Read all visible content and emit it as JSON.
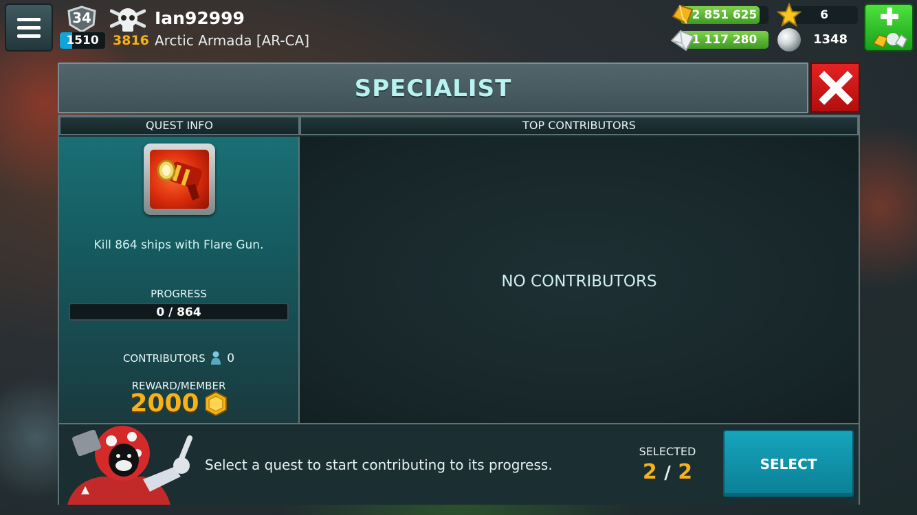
{
  "player": {
    "rank": "34",
    "xp": "1510",
    "kills": "3816",
    "username": "Ian92999",
    "guild": "Arctic Armada [AR-CA]"
  },
  "resources": {
    "gold": "2 851 625",
    "iron": "1 117 280",
    "stars": "6",
    "pearls": "1348",
    "gold_fill": 0.9,
    "iron_fill": 1.0
  },
  "dialog": {
    "title": "SPECIALIST",
    "quest_info_header": "QUEST INFO",
    "top_contributors_header": "TOP CONTRIBUTORS",
    "quest_description": "Kill 864 ships with Flare Gun.",
    "progress_label": "PROGRESS",
    "progress_text": "0 / 864",
    "progress_fraction": 0,
    "contributors_label": "CONTRIBUTORS",
    "contributors_count": "0",
    "reward_label": "REWARD/MEMBER",
    "reward_value": "2000",
    "no_contributors": "NO CONTRIBUTORS"
  },
  "footer": {
    "message": "Select a quest to start contributing to its progress.",
    "selected_label": "SELECTED",
    "selected_current": "2",
    "selected_separator": "/",
    "selected_total": "2",
    "select_button": "SELECT"
  },
  "colors": {
    "accent_gold": "#f7b21a",
    "close_red": "#e52222",
    "select_teal": "#16a5bd",
    "shop_green": "#2fc42a"
  },
  "icons": {
    "menu": "menu-icon",
    "rank": "rank-shield-icon",
    "kills": "skull-icon",
    "gold": "gold-bar-icon",
    "iron": "iron-block-icon",
    "star": "star-icon",
    "pearl": "pearl-icon",
    "shop": "shop-plus-icon",
    "close": "close-icon",
    "quest": "flare-gun-icon",
    "contributor": "person-icon",
    "coin": "coin-icon"
  }
}
